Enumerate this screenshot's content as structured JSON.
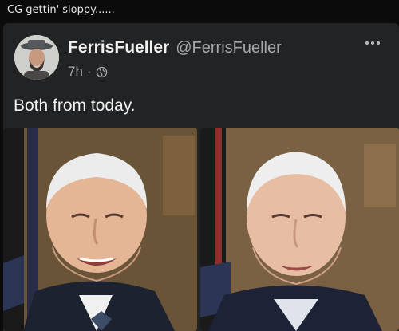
{
  "screenshot": {
    "caption": "CG gettin' sloppy......"
  },
  "post": {
    "author_name": "FerrisFueller",
    "author_handle": "@FerrisFueller",
    "time": "7h",
    "separator": "·",
    "text": "Both from today.",
    "photos": [
      {
        "name": "left-photo"
      },
      {
        "name": "right-photo"
      }
    ]
  },
  "colors": {
    "card_bg": "#222324",
    "text_primary": "#f2f2f2",
    "text_secondary": "#a4a7ab"
  },
  "icons": {
    "more": "more-dots-icon",
    "audience": "globe-icon"
  }
}
